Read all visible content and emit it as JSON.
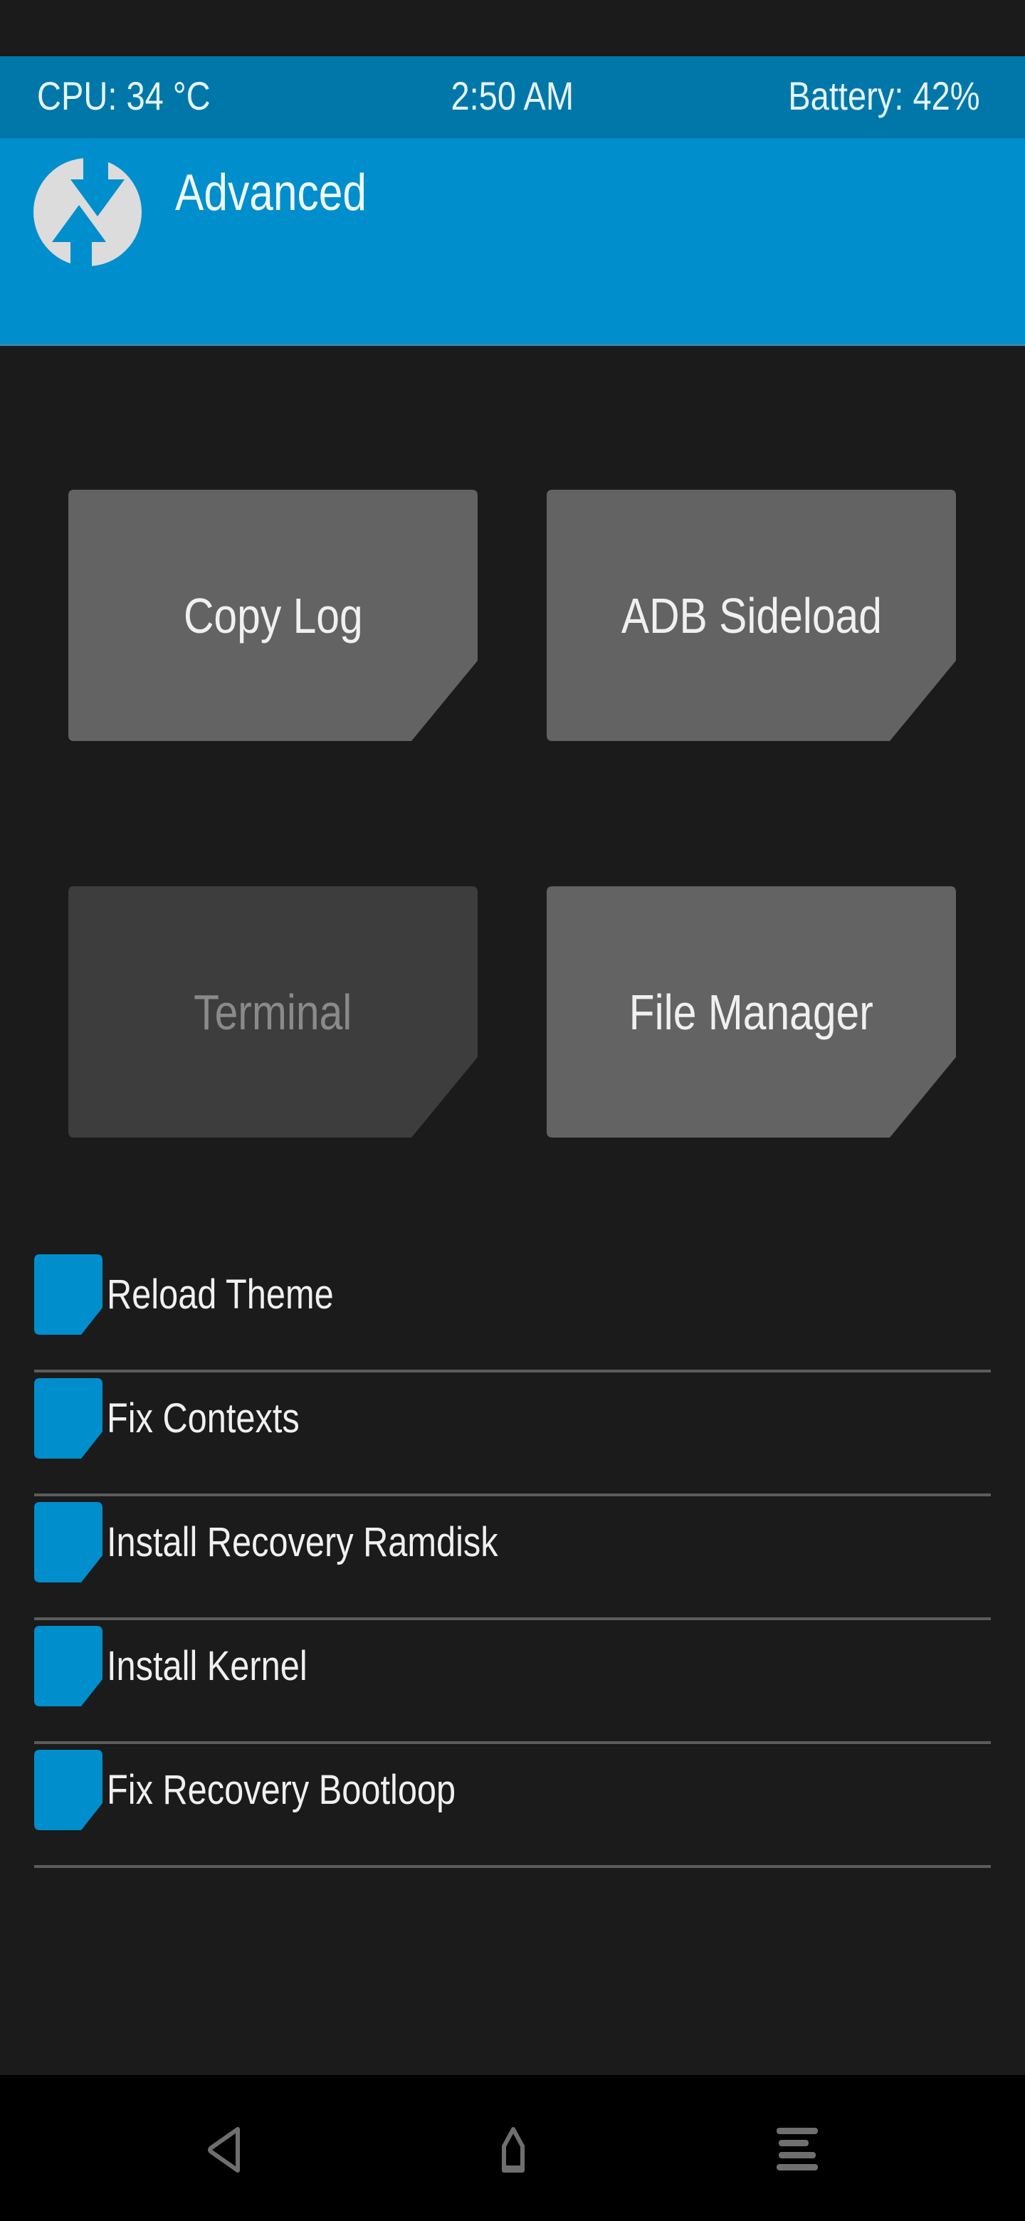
{
  "status_bar": {
    "cpu": "CPU: 34 °C",
    "time": "2:50 AM",
    "battery": "Battery: 42%"
  },
  "header": {
    "logo_icon": "twrp-logo-icon",
    "title": "Advanced"
  },
  "buttons": [
    {
      "label": "Copy Log",
      "enabled": true
    },
    {
      "label": "ADB Sideload",
      "enabled": true
    },
    {
      "label": "Terminal",
      "enabled": false
    },
    {
      "label": "File Manager",
      "enabled": true
    }
  ],
  "options": [
    {
      "label": "Reload Theme",
      "checked": false
    },
    {
      "label": "Fix Contexts",
      "checked": false
    },
    {
      "label": "Install Recovery Ramdisk",
      "checked": false
    },
    {
      "label": "Install Kernel",
      "checked": false
    },
    {
      "label": "Fix Recovery Bootloop",
      "checked": false
    }
  ],
  "navbar": {
    "back_icon": "back-triangle-icon",
    "home_icon": "home-icon",
    "menu_icon": "menu-lines-icon"
  },
  "colors": {
    "accent": "#008ecc",
    "status_bar": "#0077a8",
    "background": "#1b1b1b",
    "button": "#636363",
    "button_disabled": "#3d3d3d",
    "checkbox": "#008ecc",
    "divider": "#5c5c5c",
    "nav_icon": "#6f6f6f"
  }
}
